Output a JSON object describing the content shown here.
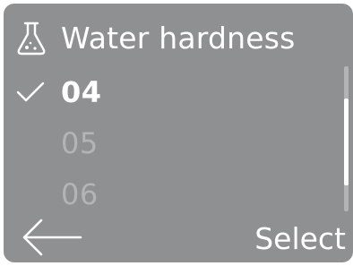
{
  "header": {
    "icon": "flask-icon",
    "title": "Water hardness"
  },
  "list": {
    "items": [
      {
        "label": "04",
        "selected": true
      },
      {
        "label": "05",
        "selected": false
      },
      {
        "label": "06",
        "selected": false
      }
    ]
  },
  "scroll": {
    "thumb_start": 0.22,
    "thumb_end": 0.82
  },
  "footer": {
    "back_icon": "arrow-left-icon",
    "select_label": "Select"
  },
  "colors": {
    "panel": "#8f9092",
    "text": "#ffffff",
    "dim_text": "#b3b4b6"
  }
}
